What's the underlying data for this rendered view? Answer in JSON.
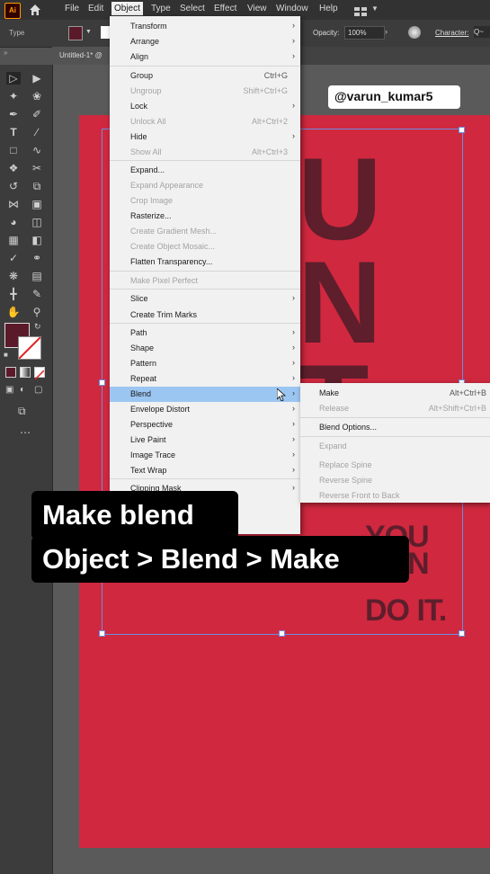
{
  "app": {
    "logo": "Ai"
  },
  "menubar": {
    "items": [
      "File",
      "Edit",
      "Object",
      "Type",
      "Select",
      "Effect",
      "View",
      "Window",
      "Help"
    ]
  },
  "control_bar": {
    "label": "Type",
    "opacity_label": "Opacity:",
    "opacity_value": "100%",
    "character_label": "Character:",
    "search": "Q~"
  },
  "document_tab": {
    "title": "Untitled-1* @"
  },
  "watermark": {
    "handle": "@varun_kumar5"
  },
  "object_menu": {
    "items": [
      {
        "label": "Transform",
        "shortcut": "",
        "submenu": true,
        "disabled": false
      },
      {
        "label": "Arrange",
        "shortcut": "",
        "submenu": true,
        "disabled": false
      },
      {
        "label": "Align",
        "shortcut": "",
        "submenu": true,
        "disabled": false
      },
      {
        "label": "Group",
        "shortcut": "Ctrl+G",
        "submenu": false,
        "disabled": false
      },
      {
        "label": "Ungroup",
        "shortcut": "Shift+Ctrl+G",
        "submenu": false,
        "disabled": true
      },
      {
        "label": "Lock",
        "shortcut": "",
        "submenu": true,
        "disabled": false
      },
      {
        "label": "Unlock All",
        "shortcut": "Alt+Ctrl+2",
        "submenu": false,
        "disabled": true
      },
      {
        "label": "Hide",
        "shortcut": "",
        "submenu": true,
        "disabled": false
      },
      {
        "label": "Show All",
        "shortcut": "Alt+Ctrl+3",
        "submenu": false,
        "disabled": true
      },
      {
        "label": "Expand...",
        "shortcut": "",
        "submenu": false,
        "disabled": false
      },
      {
        "label": "Expand Appearance",
        "shortcut": "",
        "submenu": false,
        "disabled": true
      },
      {
        "label": "Crop Image",
        "shortcut": "",
        "submenu": false,
        "disabled": true
      },
      {
        "label": "Rasterize...",
        "shortcut": "",
        "submenu": false,
        "disabled": false
      },
      {
        "label": "Create Gradient Mesh...",
        "shortcut": "",
        "submenu": false,
        "disabled": true
      },
      {
        "label": "Create Object Mosaic...",
        "shortcut": "",
        "submenu": false,
        "disabled": true
      },
      {
        "label": "Flatten Transparency...",
        "shortcut": "",
        "submenu": false,
        "disabled": false
      },
      {
        "label": "Make Pixel Perfect",
        "shortcut": "",
        "submenu": false,
        "disabled": true
      },
      {
        "label": "Slice",
        "shortcut": "",
        "submenu": true,
        "disabled": false
      },
      {
        "label": "Create Trim Marks",
        "shortcut": "",
        "submenu": false,
        "disabled": false
      },
      {
        "label": "Path",
        "shortcut": "",
        "submenu": true,
        "disabled": false
      },
      {
        "label": "Shape",
        "shortcut": "",
        "submenu": true,
        "disabled": false
      },
      {
        "label": "Pattern",
        "shortcut": "",
        "submenu": true,
        "disabled": false
      },
      {
        "label": "Repeat",
        "shortcut": "",
        "submenu": true,
        "disabled": false
      },
      {
        "label": "Blend",
        "shortcut": "",
        "submenu": true,
        "disabled": false
      },
      {
        "label": "Envelope Distort",
        "shortcut": "",
        "submenu": true,
        "disabled": false
      },
      {
        "label": "Perspective",
        "shortcut": "",
        "submenu": true,
        "disabled": false
      },
      {
        "label": "Live Paint",
        "shortcut": "",
        "submenu": true,
        "disabled": false
      },
      {
        "label": "Image Trace",
        "shortcut": "",
        "submenu": true,
        "disabled": false
      },
      {
        "label": "Text Wrap",
        "shortcut": "",
        "submenu": true,
        "disabled": false
      },
      {
        "label": "Clipping Mask",
        "shortcut": "",
        "submenu": true,
        "disabled": false
      }
    ]
  },
  "blend_menu": {
    "items": [
      {
        "label": "Make",
        "shortcut": "Alt+Ctrl+B",
        "disabled": false
      },
      {
        "label": "Release",
        "shortcut": "Alt+Shift+Ctrl+B",
        "disabled": true
      },
      {
        "label": "Blend Options...",
        "shortcut": "",
        "disabled": false
      },
      {
        "label": "Expand",
        "shortcut": "",
        "disabled": true
      },
      {
        "label": "Replace Spine",
        "shortcut": "",
        "disabled": true
      },
      {
        "label": "Reverse Spine",
        "shortcut": "",
        "disabled": true
      },
      {
        "label": "Reverse Front to Back",
        "shortcut": "",
        "disabled": true
      }
    ]
  },
  "artwork": {
    "big_letters": [
      "U",
      "N",
      "T"
    ],
    "small_text": [
      "YOU",
      "CAN",
      "DO IT."
    ]
  },
  "caption": {
    "line1": "Make blend",
    "line2": "Object > Blend > Make"
  },
  "colors": {
    "artboard": "#d0283f",
    "text_dark": "#5e1e2c",
    "highlight": "#9cc6f2",
    "fill_swatch": "#5a1a2a"
  }
}
